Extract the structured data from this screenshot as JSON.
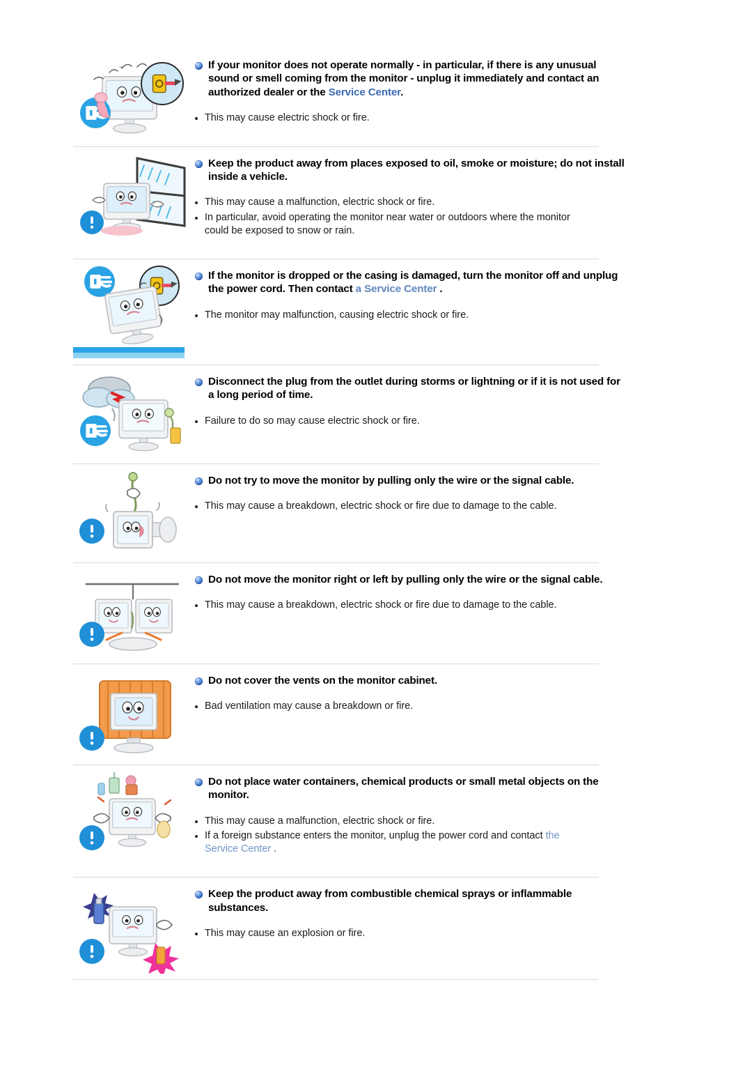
{
  "document": {
    "title": "Monitor Safety Instructions - Power / Installation",
    "accent_link_color": "#3c6bb0",
    "soft_link_color": "#5f86bd",
    "light_link_color": "#6f93c6",
    "heading_bullet_color": "#1f4fa8",
    "divider_color": "#d9d9d9",
    "warning_icon_color": "#1f8fd8"
  },
  "sections": [
    {
      "illustration_name": "monitor-smoke-smell-unplug-illustration",
      "has_warning_badge": false,
      "heading_parts": [
        {
          "text": "If your monitor does not operate normally - in particular, if there is any unusual sound or smell coming from the monitor - unplug it immediately and contact an authorized dealer or the ",
          "style": "plain"
        },
        {
          "text": "Service Center",
          "style": "link-strong"
        },
        {
          "text": ".",
          "style": "plain"
        }
      ],
      "heading_plain": "If your monitor does not operate normally - in particular, if there is any unusual sound or smell coming from the monitor - unplug it immediately and contact an authorized dealer or the Service Center.",
      "bullets": [
        {
          "parts": [
            {
              "text": "This may cause electric shock or fire.",
              "style": "plain"
            }
          ]
        }
      ]
    },
    {
      "illustration_name": "monitor-rain-window-moisture-illustration",
      "has_warning_badge": true,
      "heading_parts": [
        {
          "text": "Keep the product away from places exposed to oil, smoke or moisture; do not install inside a vehicle.",
          "style": "plain"
        }
      ],
      "heading_plain": "Keep the product away from places exposed to oil, smoke or moisture; do not install inside a vehicle.",
      "bullets": [
        {
          "parts": [
            {
              "text": "This may cause a malfunction, electric shock or fire.",
              "style": "plain"
            }
          ]
        },
        {
          "parts": [
            {
              "text": "In particular, avoid operating the monitor near water or outdoors where the monitor could be exposed to snow or rain.",
              "style": "plain"
            }
          ]
        }
      ]
    },
    {
      "illustration_name": "monitor-dropped-damaged-casing-illustration",
      "has_warning_badge": false,
      "heading_parts": [
        {
          "text": "If the monitor is dropped or the casing is damaged, turn the monitor off and unplug the power cord. Then contact ",
          "style": "plain"
        },
        {
          "text": "a Service Center",
          "style": "link-soft"
        },
        {
          "text": " .",
          "style": "plain"
        }
      ],
      "heading_plain": "If the monitor is dropped or the casing is damaged, turn the monitor off and unplug the power cord. Then contact a Service Center .",
      "bullets": [
        {
          "parts": [
            {
              "text": "The monitor may malfunction, causing electric shock or fire.",
              "style": "plain"
            }
          ]
        }
      ]
    },
    {
      "illustration_name": "monitor-storm-lightning-unplug-illustration",
      "has_warning_badge": false,
      "heading_parts": [
        {
          "text": "Disconnect the plug from the outlet during storms or lightning or if it is not used for a long period of time.",
          "style": "plain"
        }
      ],
      "heading_plain": "Disconnect the plug from the outlet during storms or lightning or if it is not used for a long period of time.",
      "bullets": [
        {
          "parts": [
            {
              "text": "Failure to do so may cause electric shock or fire.",
              "style": "plain"
            }
          ]
        }
      ]
    },
    {
      "illustration_name": "monitor-pulled-by-cable-illustration",
      "has_warning_badge": true,
      "heading_parts": [
        {
          "text": "Do not try to move the monitor by pulling only the wire or the signal cable.",
          "style": "plain"
        }
      ],
      "heading_plain": "Do not try to move the monitor by pulling only the wire or the signal cable.",
      "bullets": [
        {
          "parts": [
            {
              "text": "This may cause a breakdown, electric shock or fire due to damage to the cable.",
              "style": "plain"
            }
          ]
        }
      ]
    },
    {
      "illustration_name": "monitor-swung-left-right-by-cable-illustration",
      "has_warning_badge": true,
      "heading_parts": [
        {
          "text": "Do not move the monitor right or left by pulling only the wire or the signal cable.",
          "style": "plain"
        }
      ],
      "heading_plain": "Do not move the monitor right or left by pulling only the wire or the signal cable.",
      "bullets": [
        {
          "parts": [
            {
              "text": "This may cause a breakdown, electric shock or fire due to damage to the cable.",
              "style": "plain"
            }
          ]
        }
      ]
    },
    {
      "illustration_name": "monitor-covered-vents-blanket-illustration",
      "has_warning_badge": true,
      "heading_parts": [
        {
          "text": "Do not cover the vents on the monitor cabinet.",
          "style": "plain"
        }
      ],
      "heading_plain": "Do not cover the vents on the monitor cabinet.",
      "bullets": [
        {
          "parts": [
            {
              "text": "Bad ventilation may cause a breakdown or fire.",
              "style": "plain"
            }
          ]
        }
      ]
    },
    {
      "illustration_name": "monitor-water-containers-metal-objects-illustration",
      "has_warning_badge": true,
      "heading_parts": [
        {
          "text": "Do not place water containers, chemical products or small metal objects on the monitor.",
          "style": "plain"
        }
      ],
      "heading_plain": "Do not place water containers, chemical products or small metal objects on the monitor.",
      "bullets": [
        {
          "parts": [
            {
              "text": "This may cause a malfunction, electric shock or fire.",
              "style": "plain"
            }
          ]
        },
        {
          "parts": [
            {
              "text": "If a foreign substance enters the monitor, unplug the power cord and contact ",
              "style": "plain"
            },
            {
              "text": "the Service Center",
              "style": "link-light"
            },
            {
              "text": " .",
              "style": "plain"
            }
          ]
        }
      ]
    },
    {
      "illustration_name": "monitor-combustible-sprays-inflammable-illustration",
      "has_warning_badge": true,
      "heading_parts": [
        {
          "text": "Keep the product away from combustible chemical sprays or inflammable substances.",
          "style": "plain"
        }
      ],
      "heading_plain": "Keep the product away from combustible chemical sprays or inflammable substances.",
      "bullets": [
        {
          "parts": [
            {
              "text": "This may cause an explosion or fire.",
              "style": "plain"
            }
          ]
        }
      ]
    }
  ]
}
